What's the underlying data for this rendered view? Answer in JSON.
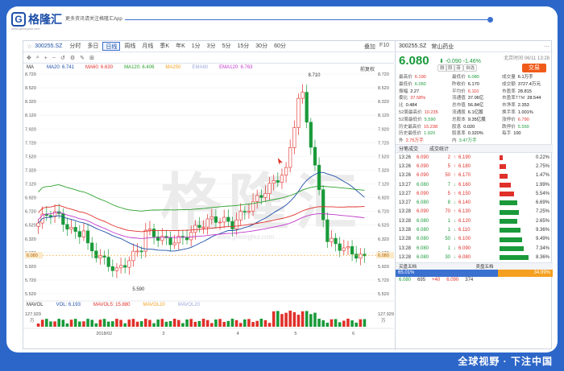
{
  "brand": {
    "name": "格隆汇",
    "mark": "G",
    "tagline": "更多资讯请关注格隆汇App",
    "url": "www.gelonghui.com"
  },
  "footer": {
    "slogan": "全球视野 · 下注中国"
  },
  "toolbar": {
    "code": "300255.SZ",
    "tabs": [
      "分时",
      "多日",
      "日线",
      "周线",
      "月线",
      "季K",
      "年K",
      "1分",
      "3分",
      "5分",
      "15分",
      "30分",
      "60分"
    ],
    "active_tab": "日线",
    "right": [
      "叠加",
      "F10"
    ],
    "tools": [
      "✥",
      "⌕",
      "+",
      "−",
      "↺",
      "⚙",
      "✎",
      "⊞"
    ]
  },
  "ma": {
    "label": "MA",
    "items": [
      {
        "text": "MA20: 6.741",
        "color": "#1d4fa8"
      },
      {
        "text": "MA60: 6.630",
        "color": "#e0302a"
      },
      {
        "text": "MA120: 6.406",
        "color": "#2aa02a"
      },
      {
        "text": "MA250",
        "color": "#f5a020"
      },
      {
        "text": "EMA60",
        "color": "#9aa8d8"
      },
      {
        "text": "EMA120: 6.763",
        "color": "#c03acb"
      }
    ],
    "fq": "前复权"
  },
  "vol": {
    "items": [
      {
        "text": "MAVOL",
        "color": "#333"
      },
      {
        "text": "VOL: 6.193",
        "color": "#1d4fa8"
      },
      {
        "text": "MAVOL5: 15.880",
        "color": "#e0302a"
      },
      {
        "text": "MAVOL10",
        "color": "#f5a020"
      },
      {
        "text": "MAVOL20",
        "color": "#9aa8d8"
      }
    ]
  },
  "watermark": {
    "text": "格隆汇",
    "sub": "www.gelonghui.com"
  },
  "chart_data": {
    "type": "candlestick",
    "ylim": [
      5.52,
      8.72
    ],
    "yticks": [
      "8.720",
      "8.520",
      "8.320",
      "8.120",
      "7.920",
      "7.720",
      "7.520",
      "7.320",
      "7.120",
      "6.920",
      "6.720",
      "6.520",
      "6.320",
      "6.120",
      "5.920",
      "5.720",
      "5.520"
    ],
    "current_price_label": "6.080",
    "annotations": [
      {
        "text": "8.710"
      },
      {
        "text": "5.590"
      }
    ],
    "xticks": [
      "2018/02",
      "3",
      "4",
      "5",
      "6"
    ],
    "vol_axis": {
      "top": "127.929",
      "unit": "万"
    },
    "ma_colors": {
      "ma20": "#1d4fa8",
      "ma60": "#e0302a",
      "ma120": "#2aa02a",
      "ema120": "#c03acb"
    }
  },
  "side": {
    "code": "300255.SZ",
    "name": "常山药业",
    "price": "6.080",
    "arrow": "⬇",
    "change": "-0.090",
    "change_pct": "-1.46%",
    "time": "北京时间 06/11 13:28",
    "badges": [
      "融",
      "股",
      "港",
      "自选"
    ],
    "trade": "交易",
    "stats": [
      [
        "最高价",
        "6.190",
        "r",
        "最低价",
        "6.080",
        "g",
        "成交量",
        "6.1万手",
        "b"
      ],
      [
        "最低价",
        "6.050",
        "g",
        "昨收价",
        "6.170",
        "b",
        "成交额",
        "3727.4万元",
        "b"
      ],
      [
        "振幅",
        "2.27",
        "b",
        "平均价",
        "6.110",
        "r",
        "市盈率",
        "28.815",
        "b"
      ],
      [
        "委比",
        "37.58%",
        "r",
        "流通值",
        "37.06亿",
        "b",
        "市盈率TTM",
        "28.544",
        "b"
      ],
      [
        "比",
        "0.484",
        "b",
        "总市值",
        "56.84亿",
        "b",
        "市净率",
        "2.353",
        "b"
      ],
      [
        "52周最高价",
        "10.235",
        "r",
        "流通股",
        "6.1亿股",
        "b",
        "换手率",
        "1.001%",
        "b"
      ],
      [
        "52周最低价",
        "5.590",
        "g",
        "总股本",
        "9.35亿股",
        "b",
        "涨停价",
        "6.790",
        "r"
      ],
      [
        "历史最高价",
        "15.238",
        "r",
        "股息",
        "0.020",
        "b",
        "跌停价",
        "5.550",
        "g"
      ],
      [
        "历史最低价",
        "1.920",
        "g",
        "股息率",
        "0.320%",
        "b",
        "每手",
        "100",
        "b"
      ],
      [
        "外",
        "2.75万手",
        "r",
        "内",
        "3.47万手",
        "g",
        "",
        "",
        "b"
      ]
    ],
    "trades_header": [
      "分笔成交",
      "成交统计"
    ],
    "trades": [
      {
        "t": "13:26",
        "p": "6.090",
        "v": "2",
        "a": "↑",
        "p2": "6.190",
        "w": 4,
        "c": "#e0302a",
        "pct": "0.22%"
      },
      {
        "t": "13:26",
        "p": "6.090",
        "v": "5",
        "a": "↑",
        "p2": "6.180",
        "w": 8,
        "c": "#e0302a",
        "pct": "2.75%"
      },
      {
        "t": "13:26",
        "p": "6.090",
        "v": "50",
        "a": "↑",
        "p2": "6.170",
        "w": 10,
        "c": "#e0302a",
        "pct": "1.47%"
      },
      {
        "t": "13:27",
        "p": "6.080",
        "v": "7",
        "a": "↓",
        "p2": "6.160",
        "w": 14,
        "c": "#e0302a",
        "pct": "1.99%"
      },
      {
        "t": "13:27",
        "p": "6.090",
        "v": "5",
        "a": "↑",
        "p2": "6.150",
        "w": 18,
        "c": "#e0302a",
        "pct": "5.54%"
      },
      {
        "t": "13:27",
        "p": "6.080",
        "v": "8",
        "a": "↓",
        "p2": "6.140",
        "w": 22,
        "c": "#1a9a3a",
        "pct": "6.69%"
      },
      {
        "t": "13:28",
        "p": "6.090",
        "v": "70",
        "a": "↑",
        "p2": "6.130",
        "w": 24,
        "c": "#1a9a3a",
        "pct": "7.25%"
      },
      {
        "t": "13:28",
        "p": "6.080",
        "v": "1",
        "a": "↓",
        "p2": "6.120",
        "w": 22,
        "c": "#1a9a3a",
        "pct": "2.65%"
      },
      {
        "t": "13:28",
        "p": "6.080",
        "v": "1",
        "a": "↓",
        "p2": "6.110",
        "w": 26,
        "c": "#1a9a3a",
        "pct": "9.36%"
      },
      {
        "t": "13:28",
        "p": "6.080",
        "v": "50",
        "a": "↓",
        "p2": "6.100",
        "w": 28,
        "c": "#1a9a3a",
        "pct": "9.49%"
      },
      {
        "t": "13:28",
        "p": "6.080",
        "v": "1",
        "a": "↓",
        "p2": "6.090",
        "w": 30,
        "c": "#1a9a3a",
        "pct": "7.34%"
      },
      {
        "t": "13:28",
        "p": "6.080",
        "v": "30",
        "a": "↓",
        "p2": "6.080",
        "w": 36,
        "c": "#1a9a3a",
        "pct": "8.36%"
      }
    ],
    "orderbook_header": [
      "买盘五档",
      "卖盘五档"
    ],
    "buy_pct": "65.01%",
    "sell_pct": "34.99%",
    "buy_frac": 0.6501,
    "ob_row": [
      "6.080",
      "695",
      "+40",
      "6.090",
      "374"
    ]
  }
}
